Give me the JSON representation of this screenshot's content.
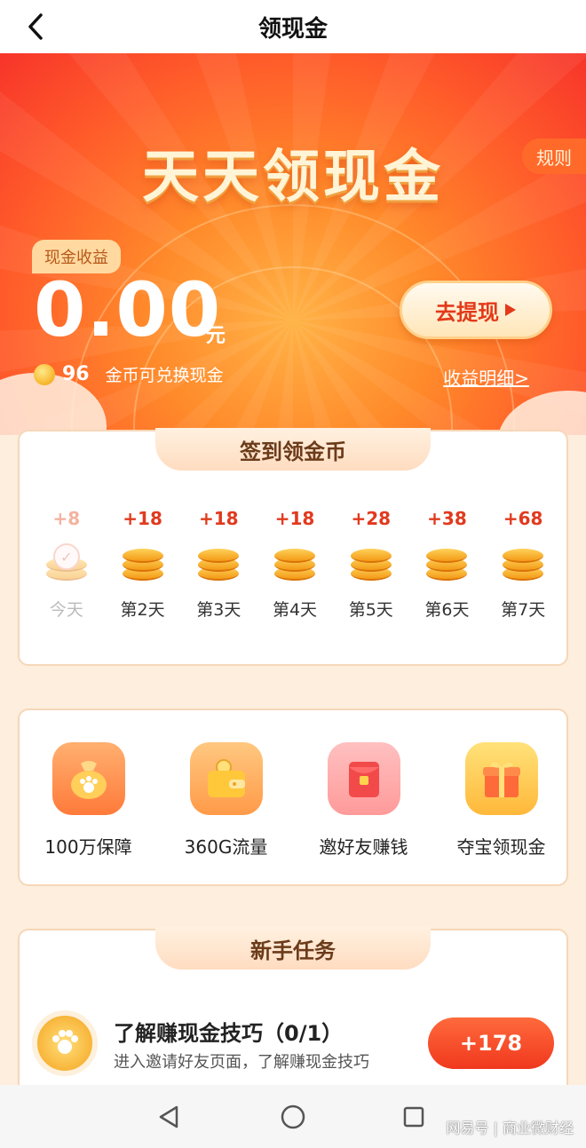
{
  "header": {
    "title": "领现金",
    "back_icon": "chevron-left-icon"
  },
  "hero": {
    "banner_title": "天天领现金",
    "rules_label": "规则",
    "cash_tag": "现金收益",
    "cash_value": "0.00",
    "cash_unit": "元",
    "withdraw_label": "去提现",
    "coins_count": "96",
    "coins_text": "金币可兑换现金",
    "detail_link": "收益明细>"
  },
  "checkin": {
    "title": "签到领金币",
    "days": [
      {
        "amount": "+8",
        "label": "今天",
        "done": true
      },
      {
        "amount": "+18",
        "label": "第2天"
      },
      {
        "amount": "+18",
        "label": "第3天"
      },
      {
        "amount": "+18",
        "label": "第4天"
      },
      {
        "amount": "+28",
        "label": "第5天"
      },
      {
        "amount": "+38",
        "label": "第6天"
      },
      {
        "amount": "+68",
        "label": "第7天"
      }
    ]
  },
  "features": [
    {
      "label": "100万保障",
      "icon": "money-bag-icon"
    },
    {
      "label": "360G流量",
      "icon": "wallet-icon"
    },
    {
      "label": "邀好友赚钱",
      "icon": "red-envelope-icon"
    },
    {
      "label": "夺宝领现金",
      "icon": "gift-box-icon"
    }
  ],
  "tasks": {
    "title": "新手任务",
    "items": [
      {
        "title": "了解赚现金技巧（0/1）",
        "desc": "进入邀请好友页面，了解赚现金技巧",
        "reward": "+178"
      }
    ]
  },
  "navbar": {
    "back": "triangle-back-icon",
    "home": "circle-home-icon",
    "recent": "square-recent-icon"
  },
  "watermark": "网易号 | 商业微财经",
  "colors": {
    "accent": "#f0381e",
    "gold": "#f6b52a",
    "cream": "#fdeedd"
  }
}
